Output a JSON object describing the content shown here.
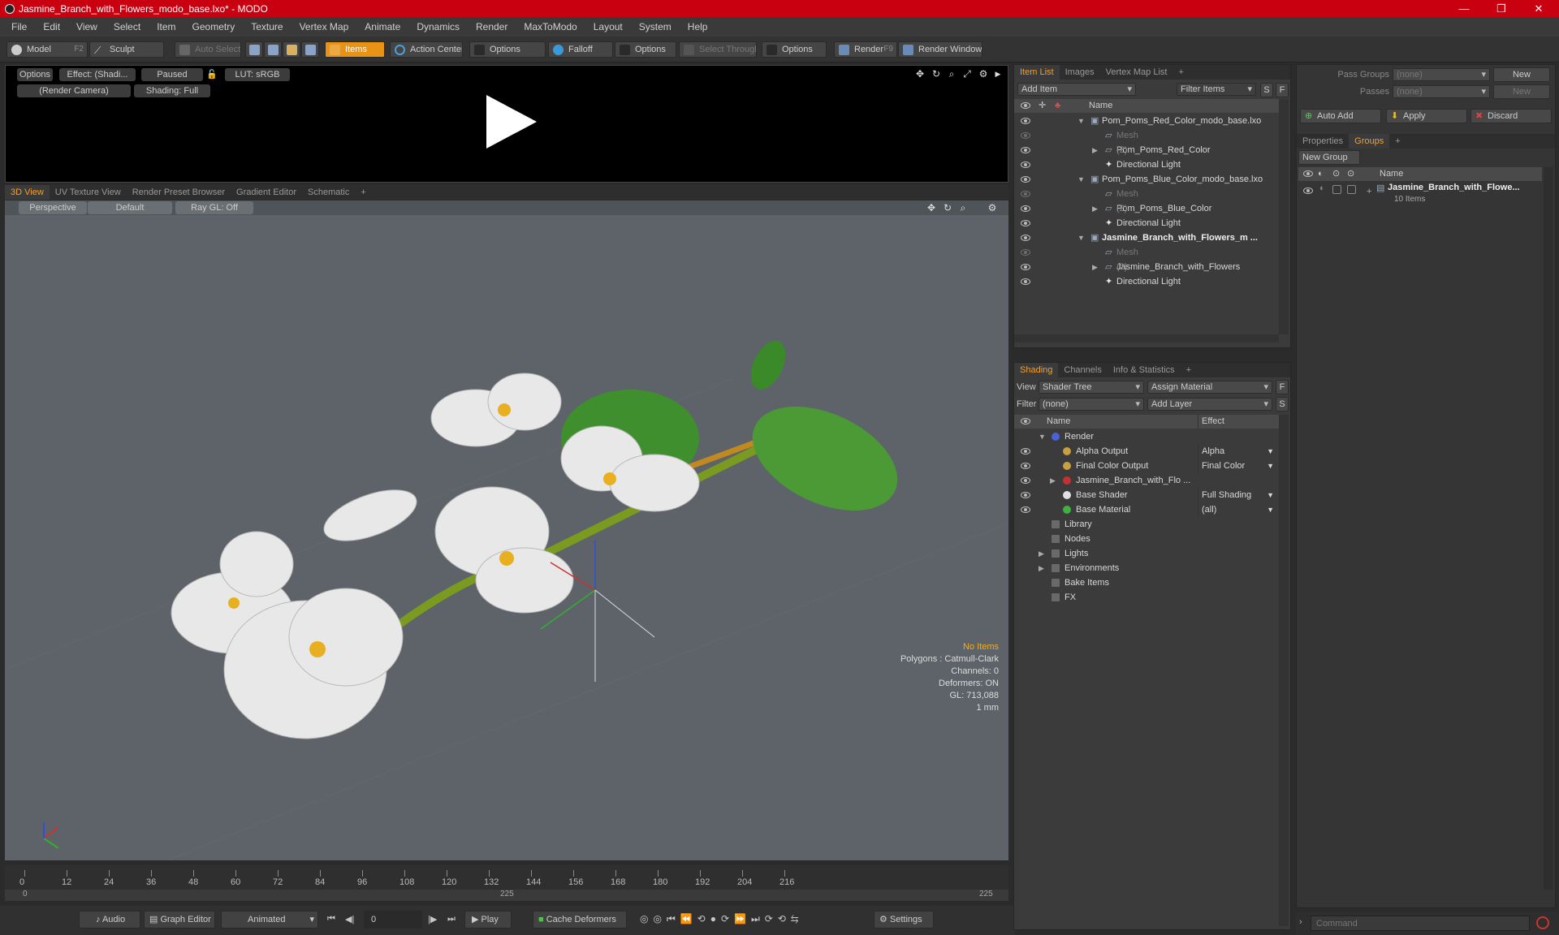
{
  "window": {
    "title": "Jasmine_Branch_with_Flowers_modo_base.lxo* - MODO"
  },
  "menu": [
    "File",
    "Edit",
    "View",
    "Select",
    "Item",
    "Geometry",
    "Texture",
    "Vertex Map",
    "Animate",
    "Dynamics",
    "Render",
    "MaxToModo",
    "Layout",
    "System",
    "Help"
  ],
  "toolbar": {
    "model": "Model",
    "model_key": "F2",
    "sculpt": "Sculpt",
    "auto_select": "Auto Select",
    "items": "Items",
    "action_center": "Action Center",
    "options1": "Options",
    "falloff": "Falloff",
    "options2": "Options",
    "select_through": "Select Through",
    "options3": "Options",
    "render": "Render",
    "render_key": "F9",
    "render_window": "Render Window"
  },
  "render_preview": {
    "options": "Options",
    "effect": "Effect: (Shadi...",
    "paused": "Paused",
    "lut": "LUT: sRGB",
    "camera": "(Render Camera)",
    "shading": "Shading: Full"
  },
  "viewport_tabs": [
    "3D View",
    "UV Texture View",
    "Render Preset Browser",
    "Gradient Editor",
    "Schematic",
    "+"
  ],
  "viewport": {
    "perspective": "Perspective",
    "default": "Default",
    "raygl": "Ray GL: Off",
    "info": {
      "no_items": "No Items",
      "polygons": "Polygons : Catmull-Clark",
      "channels": "Channels: 0",
      "deformers": "Deformers: ON",
      "gl": "GL: 713,088",
      "unit": "1 mm"
    }
  },
  "timeline": {
    "ticks": [
      "0",
      "12",
      "24",
      "36",
      "48",
      "60",
      "72",
      "84",
      "96",
      "108",
      "120",
      "132",
      "144",
      "156",
      "168",
      "180",
      "192",
      "204",
      "216"
    ],
    "range_start": "0",
    "range_mid": "225",
    "range_end": "225"
  },
  "bottombar": {
    "audio": "Audio",
    "graph_editor": "Graph Editor",
    "animated": "Animated",
    "frame": "0",
    "play": "Play",
    "cache": "Cache Deformers",
    "settings": "Settings"
  },
  "itemlist": {
    "tabs": [
      "Item List",
      "Images",
      "Vertex Map List",
      "+"
    ],
    "add_item": "Add Item",
    "filter_items": "Filter Items",
    "s": "S",
    "f": "F",
    "name_col": "Name",
    "rows": [
      {
        "label": "Pom_Poms_Red_Color_modo_base.lxo",
        "indent": 0,
        "kind": "scene",
        "dim": false,
        "bold": false,
        "count": ""
      },
      {
        "label": "Mesh",
        "indent": 1,
        "kind": "mesh",
        "dim": true,
        "bold": false,
        "count": ""
      },
      {
        "label": "Pom_Poms_Red_Color",
        "indent": 1,
        "kind": "group",
        "dim": false,
        "bold": false,
        "count": "(2)"
      },
      {
        "label": "Directional Light",
        "indent": 1,
        "kind": "light",
        "dim": false,
        "bold": false,
        "count": ""
      },
      {
        "label": "Pom_Poms_Blue_Color_modo_base.lxo",
        "indent": 0,
        "kind": "scene",
        "dim": false,
        "bold": false,
        "count": ""
      },
      {
        "label": "Mesh",
        "indent": 1,
        "kind": "mesh",
        "dim": true,
        "bold": false,
        "count": ""
      },
      {
        "label": "Pom_Poms_Blue_Color",
        "indent": 1,
        "kind": "group",
        "dim": false,
        "bold": false,
        "count": "(2)"
      },
      {
        "label": "Directional Light",
        "indent": 1,
        "kind": "light",
        "dim": false,
        "bold": false,
        "count": ""
      },
      {
        "label": "Jasmine_Branch_with_Flowers_m ...",
        "indent": 0,
        "kind": "scene",
        "dim": false,
        "bold": true,
        "count": ""
      },
      {
        "label": "Mesh",
        "indent": 1,
        "kind": "mesh",
        "dim": true,
        "bold": false,
        "count": ""
      },
      {
        "label": "Jasmine_Branch_with_Flowers",
        "indent": 1,
        "kind": "group",
        "dim": false,
        "bold": false,
        "count": "(2)"
      },
      {
        "label": "Directional Light",
        "indent": 1,
        "kind": "light",
        "dim": false,
        "bold": false,
        "count": ""
      }
    ]
  },
  "shading": {
    "tabs": [
      "Shading",
      "Channels",
      "Info & Statistics",
      "+"
    ],
    "view_label": "View",
    "view_value": "Shader Tree",
    "assign_material": "Assign Material",
    "f": "F",
    "filter_label": "Filter",
    "filter_value": "(none)",
    "add_layer": "Add Layer",
    "s": "S",
    "name_col": "Name",
    "effect_col": "Effect",
    "rows": [
      {
        "label": "Render",
        "effect": "",
        "indent": 0,
        "color": "#4a62d8",
        "eye": false,
        "expand": "open"
      },
      {
        "label": "Alpha Output",
        "effect": "Alpha",
        "indent": 1,
        "color": "#c8a040",
        "eye": true,
        "expand": ""
      },
      {
        "label": "Final Color Output",
        "effect": "Final Color",
        "indent": 1,
        "color": "#c8a040",
        "eye": true,
        "expand": ""
      },
      {
        "label": "Jasmine_Branch_with_Flo ...",
        "effect": "",
        "indent": 1,
        "color": "#c83030",
        "eye": true,
        "expand": "closed"
      },
      {
        "label": "Base Shader",
        "effect": "Full Shading",
        "indent": 1,
        "color": "#e0e0e0",
        "eye": true,
        "expand": ""
      },
      {
        "label": "Base Material",
        "effect": "(all)",
        "indent": 1,
        "color": "#40b040",
        "eye": true,
        "expand": ""
      },
      {
        "label": "Library",
        "effect": "",
        "indent": 0,
        "color": "",
        "eye": false,
        "expand": ""
      },
      {
        "label": "Nodes",
        "effect": "",
        "indent": 0,
        "color": "",
        "eye": false,
        "expand": ""
      },
      {
        "label": "Lights",
        "effect": "",
        "indent": 0,
        "color": "",
        "eye": false,
        "expand": "closed"
      },
      {
        "label": "Environments",
        "effect": "",
        "indent": 0,
        "color": "",
        "eye": false,
        "expand": "closed"
      },
      {
        "label": "Bake Items",
        "effect": "",
        "indent": 0,
        "color": "",
        "eye": false,
        "expand": ""
      },
      {
        "label": "FX",
        "effect": "",
        "indent": 0,
        "color": "",
        "eye": false,
        "expand": ""
      }
    ]
  },
  "groups_panel": {
    "pass_groups_label": "Pass Groups",
    "pass_groups_value": "(none)",
    "new1": "New",
    "passes_label": "Passes",
    "passes_value": "(none)",
    "new2": "New",
    "auto_add": "Auto Add",
    "apply": "Apply",
    "discard": "Discard",
    "tabs": [
      "Properties",
      "Groups",
      "+"
    ],
    "new_group": "New Group",
    "name_col": "Name",
    "group_name": "Jasmine_Branch_with_Flowe...",
    "group_count": "10 Items"
  },
  "command": {
    "placeholder": "Command"
  },
  "colors": {
    "titlebar": "#c8000f",
    "accent": "#e89316",
    "viewport_bg": "#5d6368"
  }
}
